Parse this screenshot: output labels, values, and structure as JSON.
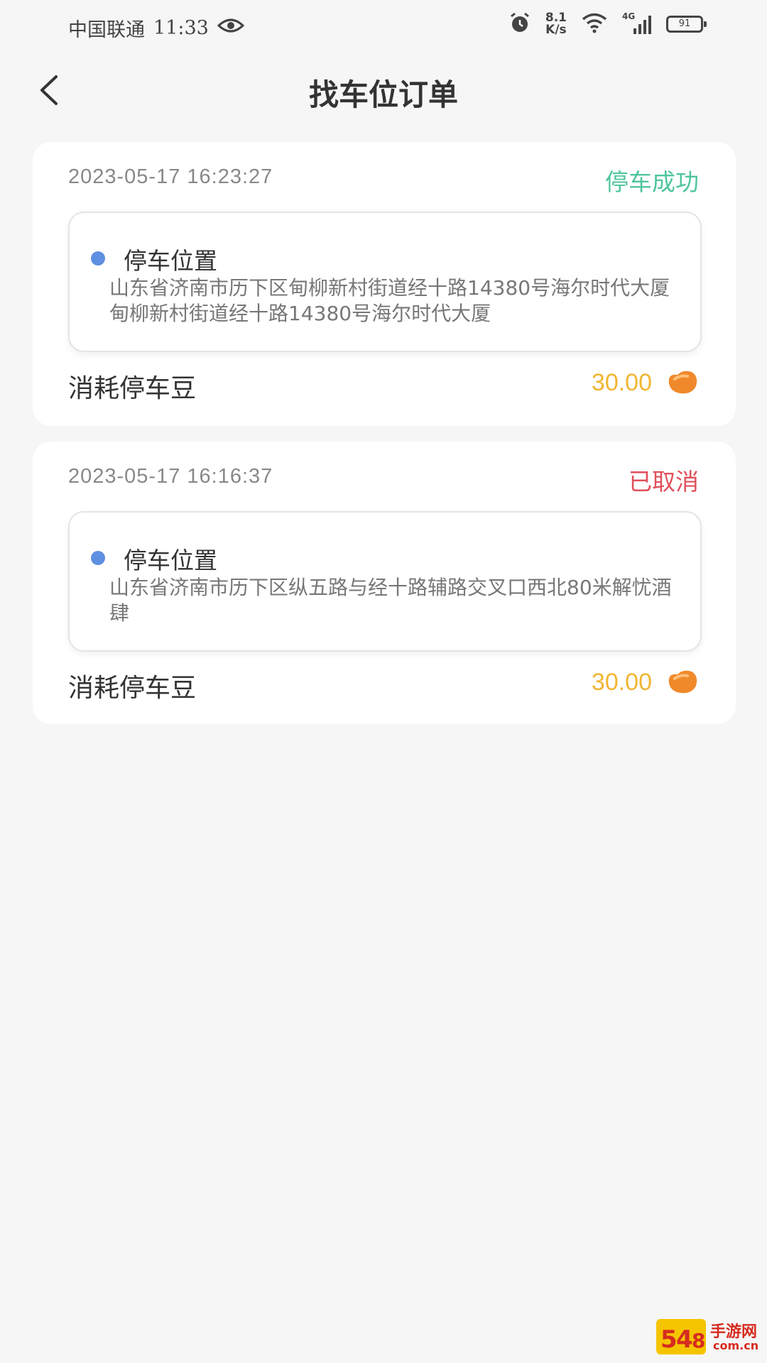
{
  "status_bar": {
    "carrier": "中国联通",
    "time": "11:33",
    "speed_value": "8.1",
    "speed_unit": "K/s",
    "network": "4G",
    "battery": "91"
  },
  "header": {
    "title": "找车位订单"
  },
  "orders": [
    {
      "time": "2023-05-17 16:23:27",
      "status": "停车成功",
      "location_label": "停车位置",
      "address": "山东省济南市历下区甸柳新村街道经十路14380号海尔时代大厦甸柳新村街道经十路14380号海尔时代大厦",
      "cost_label": "消耗停车豆",
      "cost_value": "30.00"
    },
    {
      "time": "2023-05-17 16:16:37",
      "status": "已取消",
      "location_label": "停车位置",
      "address": "山东省济南市历下区纵五路与经十路辅路交叉口西北80米解忧酒肆",
      "cost_label": "消耗停车豆",
      "cost_value": "30.00"
    }
  ],
  "watermark": {
    "text": "手游网",
    "sub": "com.cn"
  },
  "colors": {
    "success": "#4fc59f",
    "cancel": "#e0505b",
    "cost": "#f1b632",
    "dot": "#5f8fe0"
  },
  "icons": [
    "back-arrow-icon",
    "eye-icon",
    "alarm-icon",
    "wifi-icon",
    "signal-icon",
    "battery-icon",
    "bean-icon"
  ]
}
